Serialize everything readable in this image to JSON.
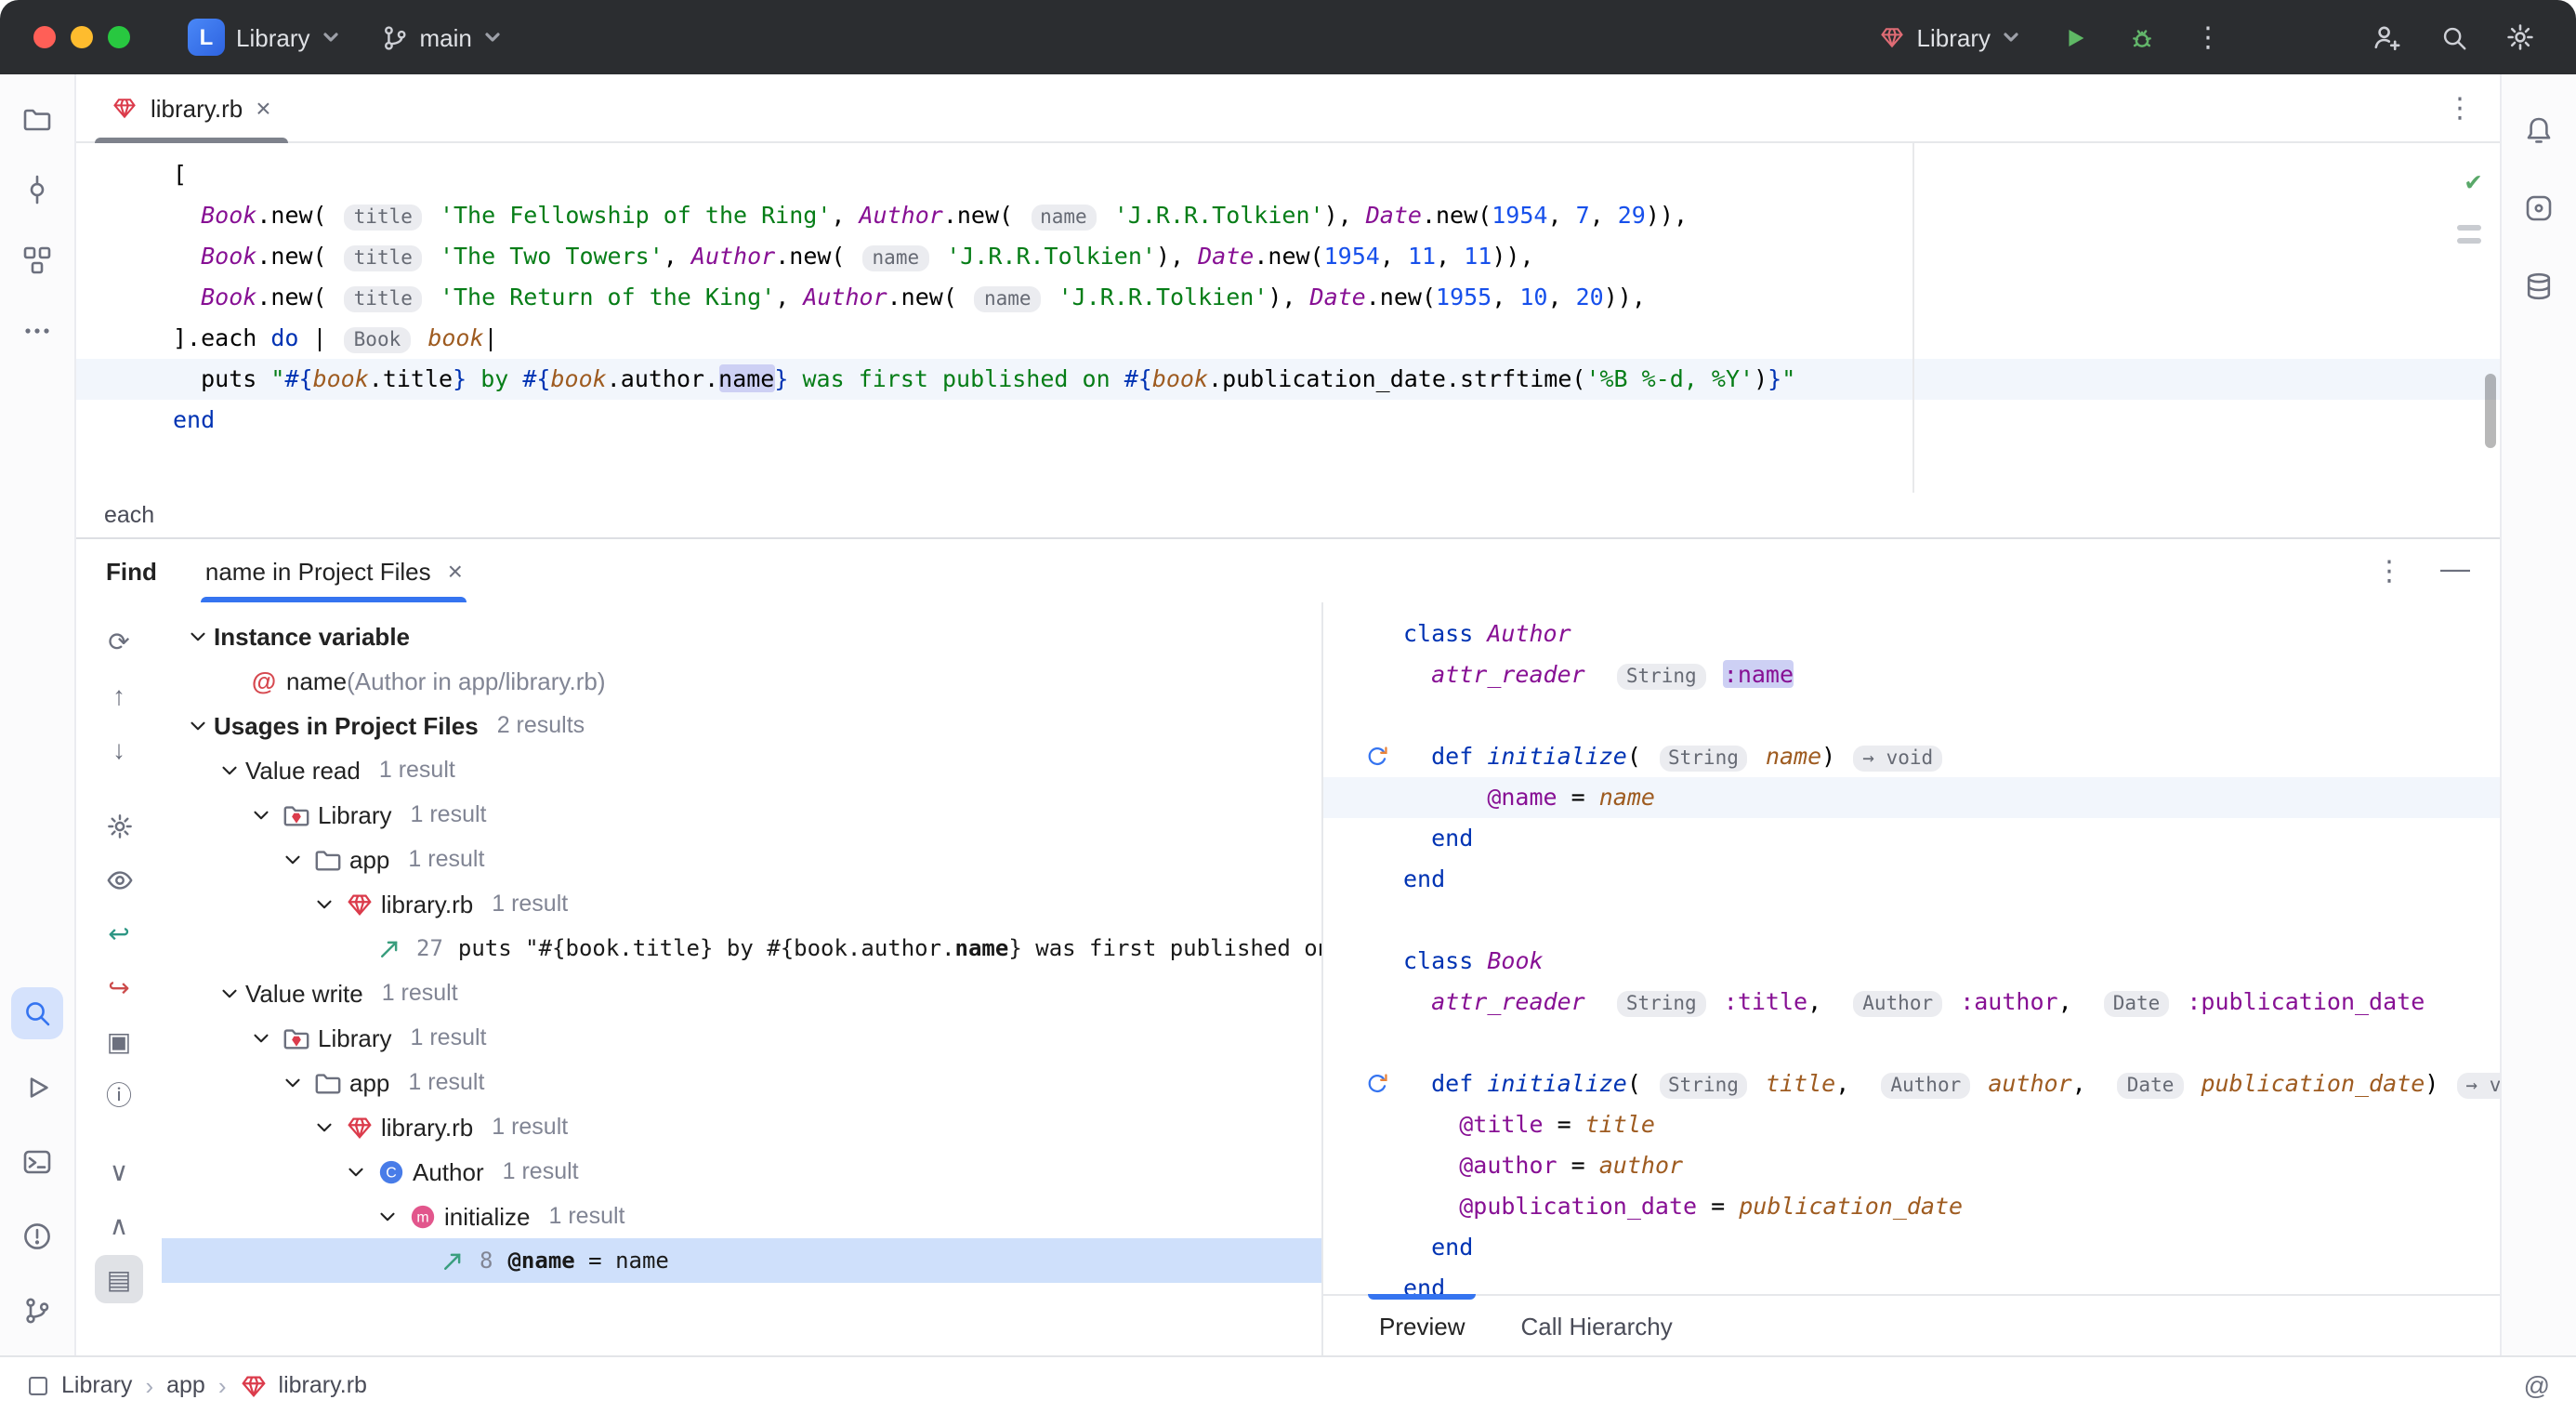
{
  "colors": {
    "accent": "#3574F0",
    "run_green": "#59A869",
    "gem_red": "#DB3B4B",
    "selection": "#CFE0FB",
    "highlight": "#CDD0F4"
  },
  "titlebar": {
    "project": {
      "logo_letter": "L",
      "name": "Library"
    },
    "branch": "main",
    "run_config": "Library"
  },
  "tabbar": {
    "tab": "library.rb",
    "close": "×",
    "more": "⋮"
  },
  "editor": {
    "breadcrumb": "each",
    "lines": [
      {
        "segs": [
          [
            "p",
            "["
          ]
        ]
      },
      {
        "segs": [
          [
            "p",
            "  "
          ],
          [
            "const",
            "Book"
          ],
          [
            "p",
            ".new( "
          ],
          [
            "hint",
            "title"
          ],
          [
            "p",
            " "
          ],
          [
            "str",
            "'The Fellowship of the Ring'"
          ],
          [
            "p",
            ", "
          ],
          [
            "const",
            "Author"
          ],
          [
            "p",
            ".new( "
          ],
          [
            "hint",
            "name"
          ],
          [
            "p",
            " "
          ],
          [
            "str",
            "'J.R.R.Tolkien'"
          ],
          [
            "p",
            "), "
          ],
          [
            "const",
            "Date"
          ],
          [
            "p",
            ".new("
          ],
          [
            "num",
            "1954"
          ],
          [
            "p",
            ", "
          ],
          [
            "num",
            "7"
          ],
          [
            "p",
            ", "
          ],
          [
            "num",
            "29"
          ],
          [
            "p",
            ")),"
          ]
        ]
      },
      {
        "segs": [
          [
            "p",
            "  "
          ],
          [
            "const",
            "Book"
          ],
          [
            "p",
            ".new( "
          ],
          [
            "hint",
            "title"
          ],
          [
            "p",
            " "
          ],
          [
            "str",
            "'The Two Towers'"
          ],
          [
            "p",
            ", "
          ],
          [
            "const",
            "Author"
          ],
          [
            "p",
            ".new( "
          ],
          [
            "hint",
            "name"
          ],
          [
            "p",
            " "
          ],
          [
            "str",
            "'J.R.R.Tolkien'"
          ],
          [
            "p",
            "), "
          ],
          [
            "const",
            "Date"
          ],
          [
            "p",
            ".new("
          ],
          [
            "num",
            "1954"
          ],
          [
            "p",
            ", "
          ],
          [
            "num",
            "11"
          ],
          [
            "p",
            ", "
          ],
          [
            "num",
            "11"
          ],
          [
            "p",
            ")),"
          ]
        ]
      },
      {
        "segs": [
          [
            "p",
            "  "
          ],
          [
            "const",
            "Book"
          ],
          [
            "p",
            ".new( "
          ],
          [
            "hint",
            "title"
          ],
          [
            "p",
            " "
          ],
          [
            "str",
            "'The Return of the King'"
          ],
          [
            "p",
            ", "
          ],
          [
            "const",
            "Author"
          ],
          [
            "p",
            ".new( "
          ],
          [
            "hint",
            "name"
          ],
          [
            "p",
            " "
          ],
          [
            "str",
            "'J.R.R.Tolkien'"
          ],
          [
            "p",
            "), "
          ],
          [
            "const",
            "Date"
          ],
          [
            "p",
            ".new("
          ],
          [
            "num",
            "1955"
          ],
          [
            "p",
            ", "
          ],
          [
            "num",
            "10"
          ],
          [
            "p",
            ", "
          ],
          [
            "num",
            "20"
          ],
          [
            "p",
            ")),"
          ]
        ]
      },
      {
        "segs": [
          [
            "p",
            "].each "
          ],
          [
            "kw",
            "do"
          ],
          [
            "p",
            " | "
          ],
          [
            "hint",
            "Book"
          ],
          [
            "p",
            " "
          ],
          [
            "param",
            "book"
          ],
          [
            "p",
            "|"
          ]
        ]
      },
      {
        "caret": true,
        "segs": [
          [
            "p",
            "  puts "
          ],
          [
            "str",
            "\""
          ],
          [
            "interp",
            "#{"
          ],
          [
            "param",
            "book"
          ],
          [
            "p",
            ".title"
          ],
          [
            "interp",
            "}"
          ],
          [
            "str",
            " by "
          ],
          [
            "interp",
            "#{"
          ],
          [
            "param",
            "book"
          ],
          [
            "p",
            ".author."
          ],
          [
            "hl",
            "name"
          ],
          [
            "interp",
            "}"
          ],
          [
            "str",
            " was first published on "
          ],
          [
            "interp",
            "#{"
          ],
          [
            "param",
            "book"
          ],
          [
            "p",
            ".publication_date.strftime("
          ],
          [
            "str",
            "'%B %-d, %Y'"
          ],
          [
            "p",
            ")"
          ],
          [
            "interp",
            "}"
          ],
          [
            "str",
            "\""
          ]
        ]
      },
      {
        "segs": [
          [
            "kw",
            "end"
          ]
        ]
      }
    ]
  },
  "left_rail": {
    "top": [
      "project",
      "commit",
      "structure",
      "more"
    ],
    "bottom": [
      "search",
      "run",
      "terminal",
      "problems",
      "vcs"
    ],
    "active": "search"
  },
  "right_rail": {
    "top": [
      "bell",
      "ai",
      "database"
    ]
  },
  "find": {
    "label": "Find",
    "tab": "name in Project Files",
    "tab_close": "×",
    "header_more": "⋮",
    "header_minimize": "—",
    "toolbar": [
      {
        "name": "rerun-icon",
        "glyph": "⟳"
      },
      {
        "name": "previous-occurrence-icon",
        "glyph": "↑"
      },
      {
        "name": "next-occurrence-icon",
        "glyph": "↓"
      },
      {
        "name": "divider"
      },
      {
        "name": "settings-icon",
        "icon": "gear"
      },
      {
        "name": "preview-toggle-icon",
        "icon": "eye"
      },
      {
        "name": "jump-to-source-icon",
        "glyph": "↩",
        "tint": "teal"
      },
      {
        "name": "autoscroll-to-source-icon",
        "glyph": "↪",
        "tint": "red"
      },
      {
        "name": "group-by-icon",
        "glyph": "▣"
      },
      {
        "name": "info-icon",
        "glyph": "ⓘ"
      },
      {
        "name": "divider"
      },
      {
        "name": "expand-all-icon",
        "glyph": "∨"
      },
      {
        "name": "collapse-all-icon",
        "glyph": "∧"
      },
      {
        "name": "layout-icon",
        "glyph": "▤",
        "active": true
      }
    ],
    "tree": [
      {
        "id": "instance-variable",
        "indent": 0,
        "chevron": true,
        "label": "Instance variable",
        "bold": true
      },
      {
        "id": "ivar-name",
        "indent": 1,
        "icon": "ivar",
        "label": "name",
        "note": "(Author in app/library.rb)"
      },
      {
        "id": "usages-header",
        "indent": 0,
        "chevron": true,
        "label": "Usages in Project Files",
        "bold": true,
        "count": "2 results"
      },
      {
        "id": "value-read",
        "indent": 1,
        "chevron": true,
        "label": "Value read",
        "count": "1 result"
      },
      {
        "id": "read-library",
        "indent": 2,
        "chevron": true,
        "icon": "library-folder",
        "label": "Library",
        "count": "1 result"
      },
      {
        "id": "read-app",
        "indent": 3,
        "chevron": true,
        "icon": "folder",
        "label": "app",
        "count": "1 result"
      },
      {
        "id": "read-library-rb",
        "indent": 4,
        "chevron": true,
        "icon": "gem",
        "label": "library.rb",
        "count": "1 result"
      },
      {
        "id": "read-usage-27",
        "indent": 5,
        "icon": "usage",
        "lineno": "27",
        "code": [
          [
            "p",
            "puts \"#{book.title} by #{book.author."
          ],
          [
            "b",
            "name"
          ],
          [
            "p",
            "} was first published on #{book.pu"
          ]
        ]
      },
      {
        "id": "value-write",
        "indent": 1,
        "chevron": true,
        "label": "Value write",
        "count": "1 result"
      },
      {
        "id": "write-library",
        "indent": 2,
        "chevron": true,
        "icon": "library-folder",
        "label": "Library",
        "count": "1 result"
      },
      {
        "id": "write-app",
        "indent": 3,
        "chevron": true,
        "icon": "folder",
        "label": "app",
        "count": "1 result"
      },
      {
        "id": "write-library-rb",
        "indent": 4,
        "chevron": true,
        "icon": "gem",
        "label": "library.rb",
        "count": "1 result"
      },
      {
        "id": "write-author",
        "indent": 5,
        "chevron": true,
        "icon": "class",
        "label": "Author",
        "count": "1 result"
      },
      {
        "id": "write-initialize",
        "indent": 6,
        "chevron": true,
        "icon": "method",
        "label": "initialize",
        "count": "1 result"
      },
      {
        "id": "write-usage-8",
        "indent": 7,
        "icon": "usage",
        "lineno": "8",
        "code": [
          [
            "b",
            "@name"
          ],
          [
            "p",
            " = name"
          ]
        ],
        "selected": true
      }
    ]
  },
  "preview": {
    "lines": [
      {
        "segs": [
          [
            "kw",
            "class"
          ],
          [
            "p",
            " "
          ],
          [
            "const",
            "Author"
          ]
        ]
      },
      {
        "segs": [
          [
            "p",
            "  "
          ],
          [
            "decl",
            "attr_reader"
          ],
          [
            "p",
            "  "
          ],
          [
            "hint",
            "String"
          ],
          [
            "p",
            " "
          ],
          [
            "symhl",
            ":name"
          ]
        ]
      },
      {
        "segs": []
      },
      {
        "gutter": true,
        "segs": [
          [
            "p",
            "  "
          ],
          [
            "kw",
            "def"
          ],
          [
            "p",
            " "
          ],
          [
            "mdef",
            "initialize"
          ],
          [
            "p",
            "( "
          ],
          [
            "hint",
            "String"
          ],
          [
            "p",
            " "
          ],
          [
            "param",
            "name"
          ],
          [
            "p",
            ") "
          ],
          [
            "hint",
            "→ void"
          ]
        ]
      },
      {
        "caret": true,
        "segs": [
          [
            "p",
            "      "
          ],
          [
            "ivar",
            "@name"
          ],
          [
            "p",
            " = "
          ],
          [
            "param",
            "name"
          ]
        ]
      },
      {
        "segs": [
          [
            "p",
            "  "
          ],
          [
            "kw",
            "end"
          ]
        ]
      },
      {
        "segs": [
          [
            "kw",
            "end"
          ]
        ]
      },
      {
        "segs": []
      },
      {
        "segs": [
          [
            "kw",
            "class"
          ],
          [
            "p",
            " "
          ],
          [
            "const",
            "Book"
          ]
        ]
      },
      {
        "segs": [
          [
            "p",
            "  "
          ],
          [
            "decl",
            "attr_reader"
          ],
          [
            "p",
            "  "
          ],
          [
            "hint",
            "String"
          ],
          [
            "p",
            " "
          ],
          [
            "sym",
            ":title"
          ],
          [
            "p",
            ",  "
          ],
          [
            "hint",
            "Author"
          ],
          [
            "p",
            " "
          ],
          [
            "sym",
            ":author"
          ],
          [
            "p",
            ",  "
          ],
          [
            "hint",
            "Date"
          ],
          [
            "p",
            " "
          ],
          [
            "sym",
            ":publication_date"
          ]
        ]
      },
      {
        "segs": []
      },
      {
        "gutter": true,
        "segs": [
          [
            "p",
            "  "
          ],
          [
            "kw",
            "def"
          ],
          [
            "p",
            " "
          ],
          [
            "mdef",
            "initialize"
          ],
          [
            "p",
            "( "
          ],
          [
            "hint",
            "String"
          ],
          [
            "p",
            " "
          ],
          [
            "param",
            "title"
          ],
          [
            "p",
            ",  "
          ],
          [
            "hint",
            "Author"
          ],
          [
            "p",
            " "
          ],
          [
            "param",
            "author"
          ],
          [
            "p",
            ",  "
          ],
          [
            "hint",
            "Date"
          ],
          [
            "p",
            " "
          ],
          [
            "param",
            "publication_date"
          ],
          [
            "p",
            ") "
          ],
          [
            "hint",
            "→ void"
          ]
        ]
      },
      {
        "segs": [
          [
            "p",
            "    "
          ],
          [
            "ivar",
            "@title"
          ],
          [
            "p",
            " = "
          ],
          [
            "param",
            "title"
          ]
        ]
      },
      {
        "segs": [
          [
            "p",
            "    "
          ],
          [
            "ivar",
            "@author"
          ],
          [
            "p",
            " = "
          ],
          [
            "param",
            "author"
          ]
        ]
      },
      {
        "segs": [
          [
            "p",
            "    "
          ],
          [
            "ivar",
            "@publication_date"
          ],
          [
            "p",
            " = "
          ],
          [
            "param",
            "publication_date"
          ]
        ]
      },
      {
        "segs": [
          [
            "p",
            "  "
          ],
          [
            "kw",
            "end"
          ]
        ]
      },
      {
        "segs": [
          [
            "kw",
            "end"
          ]
        ]
      }
    ],
    "tabs": [
      {
        "label": "Preview",
        "active": true
      },
      {
        "label": "Call Hierarchy",
        "active": false
      }
    ]
  },
  "statusbar": {
    "crumbs": [
      {
        "icon": "module",
        "label": "Library"
      },
      {
        "label": "app"
      },
      {
        "icon": "gem",
        "label": "library.rb"
      }
    ],
    "right_icon_glyph": "@"
  }
}
